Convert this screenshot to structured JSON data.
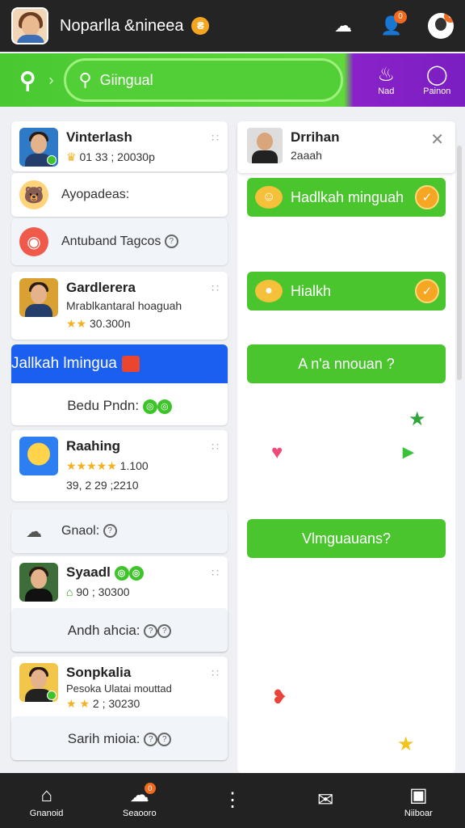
{
  "header": {
    "title": "Noparlla &nineea",
    "coin_glyph": "₴",
    "icons": [
      "group-icon",
      "notification-user-icon",
      "profile-avatar-icon"
    ],
    "notif_badge": "0",
    "profile_badge": "0"
  },
  "search": {
    "value": "Giingual",
    "btn1_label": "Nad",
    "btn2_label": "Painon",
    "accent": "#5fd93c",
    "purple": "#8a22c9"
  },
  "left": {
    "card1": {
      "name": "Vinterlash",
      "stats": "01 33 ; 20030p"
    },
    "row1": {
      "text": "Ayopadeas:"
    },
    "row2": {
      "text": "Antuband Tagcos"
    },
    "card2": {
      "name": "Gardlerera",
      "line1": "Mrablkantaral hoaguah",
      "line2": "30.300n"
    },
    "blue": {
      "title": "Jallkah lmingua",
      "sub": "Bedu Pndn:"
    },
    "card3": {
      "name": "Raahing",
      "rating": "1.100",
      "line2": "39, 2 29 ;2210"
    },
    "row3": {
      "text": "Gnaol:"
    },
    "card4": {
      "name": "Syaadl",
      "stats": "90 ; 30300",
      "sub": "Andh ahcia:"
    },
    "card5": {
      "name": "Sonpkalia",
      "line1": "Pesoka Ulatai mouttad",
      "stats": "2 ; 30230",
      "sub": "Sarih mioia:"
    }
  },
  "right": {
    "name": "Drrihan",
    "sub": "2aaah",
    "btn1": "Hadlkah minguah",
    "btn2": "Hialkh",
    "btn3": "A n'a nnouan ?",
    "btn4": "Vlmguauans?"
  },
  "nav": {
    "items": [
      "Gnanoid",
      "Seaooro",
      "",
      "",
      "Niiboar"
    ],
    "badge": "0"
  }
}
